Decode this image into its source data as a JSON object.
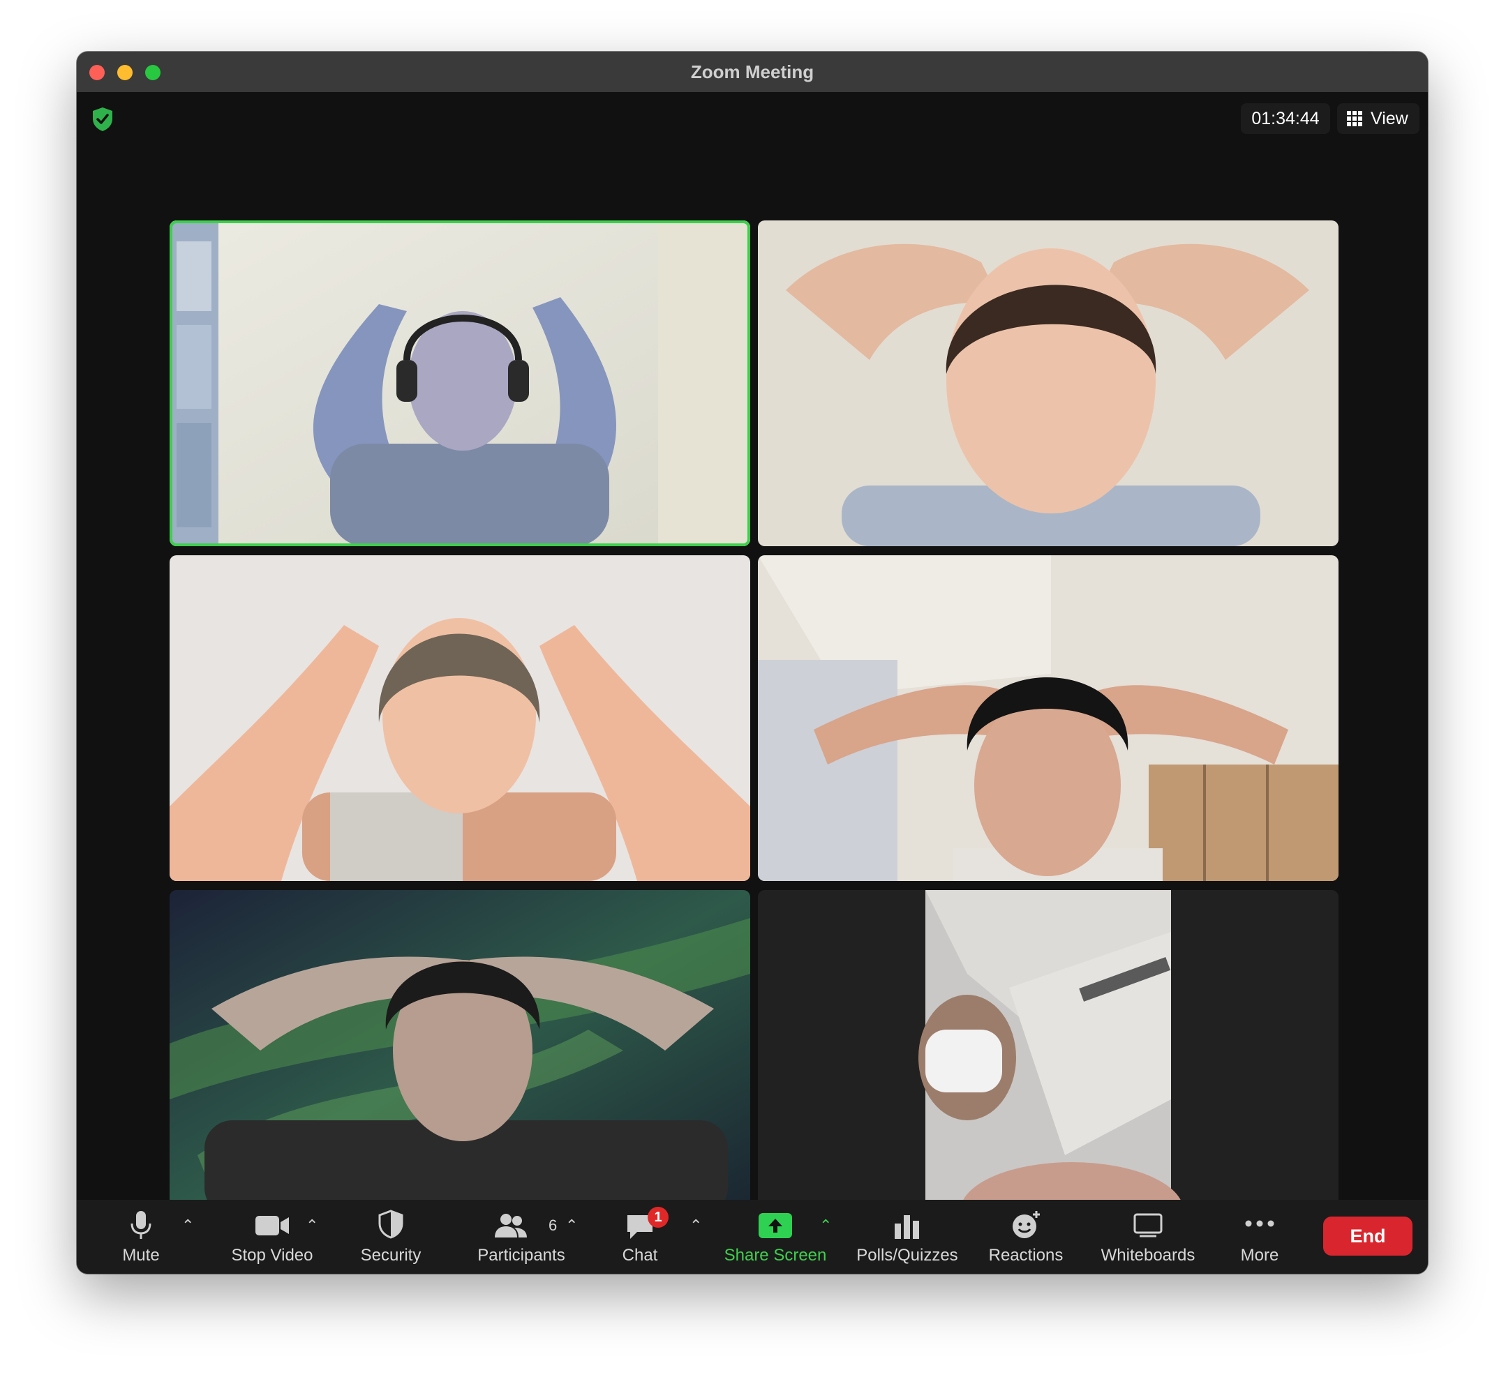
{
  "window": {
    "title": "Zoom Meeting"
  },
  "top_bar": {
    "timer": "01:34:44",
    "view_label": "View",
    "security_status": "encrypted"
  },
  "video_grid": {
    "active_speaker_color": "#3ecf4d",
    "tiles": [
      {
        "name": "participant-video-1",
        "active": true
      },
      {
        "name": "participant-video-2",
        "active": false
      },
      {
        "name": "participant-video-3",
        "active": false
      },
      {
        "name": "participant-video-4",
        "active": false
      },
      {
        "name": "participant-video-5",
        "active": false
      },
      {
        "name": "participant-video-6",
        "active": false
      }
    ]
  },
  "toolbar": {
    "mute_label": "Mute",
    "stop_video_label": "Stop Video",
    "security_label": "Security",
    "participants_label": "Participants",
    "participants_count": "6",
    "chat_label": "Chat",
    "chat_badge": "1",
    "share_screen_label": "Share Screen",
    "polls_label": "Polls/Quizzes",
    "reactions_label": "Reactions",
    "whiteboards_label": "Whiteboards",
    "more_label": "More",
    "end_label": "End",
    "accent_color": "#3ecf4d",
    "end_color": "#d9262e"
  }
}
